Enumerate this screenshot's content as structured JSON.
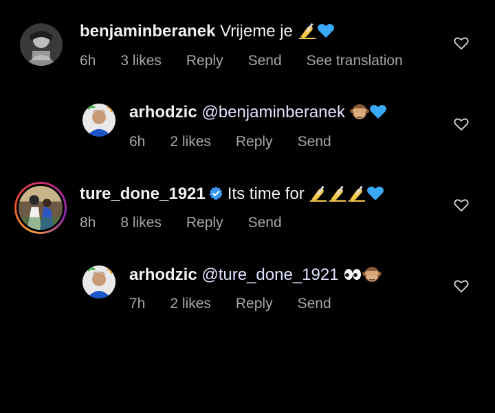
{
  "comments": [
    {
      "username": "benjaminberanek",
      "text": "Vrijeme je",
      "time": "6h",
      "likes": "3 likes",
      "reply": "Reply",
      "send": "Send",
      "translate": "See translation"
    },
    {
      "username": "arhodzic",
      "text": "@benjaminberanek",
      "time": "6h",
      "likes": "2 likes",
      "reply": "Reply",
      "send": "Send"
    },
    {
      "username": "ture_done_1921",
      "text": "Its time for",
      "time": "8h",
      "likes": "8 likes",
      "reply": "Reply",
      "send": "Send"
    },
    {
      "username": "arhodzic",
      "text": "@ture_done_1921",
      "time": "7h",
      "likes": "2 likes",
      "reply": "Reply",
      "send": "Send"
    }
  ],
  "icons": {
    "like": "heart-outline-icon",
    "verified": "verified-badge-icon"
  },
  "colors": {
    "background": "#000000",
    "text": "#f2f2f2",
    "secondary": "#a8a8a8",
    "verified": "#3897f0",
    "story_ring": "#e8432f"
  }
}
